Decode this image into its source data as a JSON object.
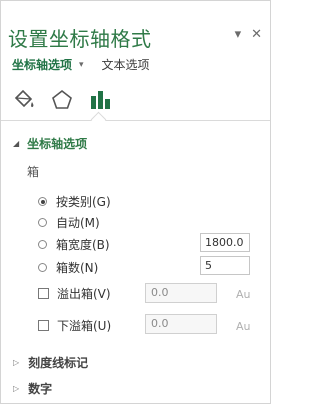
{
  "pane": {
    "title": "设置坐标轴格式",
    "controls": {
      "dropdown": "▾",
      "close": "✕"
    }
  },
  "tabs": {
    "active": "坐标轴选项",
    "active_dropdown": "▾",
    "other": "文本选项"
  },
  "icons": [
    "paint-bucket-icon",
    "pentagon-icon",
    "bar-chart-icon"
  ],
  "section": {
    "title": "坐标轴选项",
    "group_label": "箱",
    "options": [
      {
        "label": "按类别(G)",
        "selected": true
      },
      {
        "label": "自动(M)",
        "selected": false
      },
      {
        "label": "箱宽度(B)",
        "selected": false,
        "value": "1800.0"
      },
      {
        "label": "箱数(N)",
        "selected": false,
        "value": "5"
      }
    ],
    "checks": [
      {
        "label": "溢出箱(V)",
        "checked": false,
        "value": "0.0",
        "suffix": "Au"
      },
      {
        "label": "下溢箱(U)",
        "checked": false,
        "value": "0.0",
        "suffix": "Au"
      }
    ]
  },
  "collapsed_sections": [
    "刻度线标记",
    "数字"
  ],
  "colors": {
    "accent": "#217346",
    "title": "#2f7a47"
  }
}
